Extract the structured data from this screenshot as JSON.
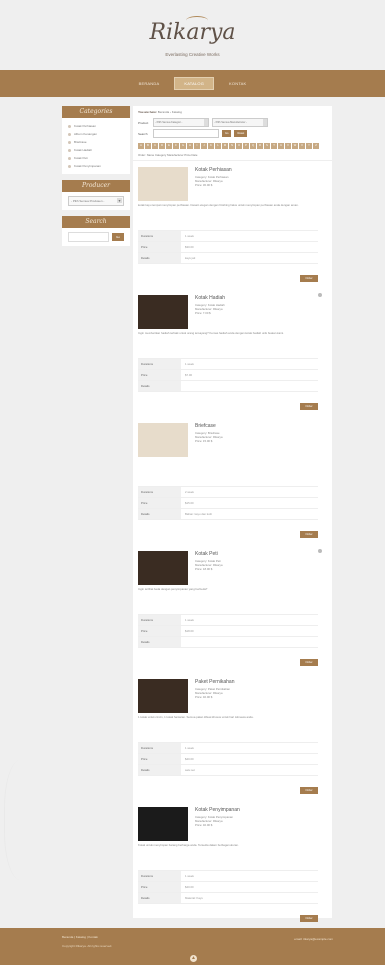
{
  "header": {
    "logo": "Rikarya",
    "tagline": "Everlasting Creative Works"
  },
  "nav": {
    "items": [
      "BERANDA",
      "KATALOG",
      "KONTAK"
    ],
    "active": "KATALOG"
  },
  "sidebar": {
    "categories_title": "Categories",
    "categories": [
      "Kotak Perhiasan",
      "Album Kenangan",
      "Briefcase",
      "Kotak Hadiah",
      "Kotak Peti",
      "Kotak Penyimpanan"
    ],
    "producer_title": "Producer",
    "producer_select": "- Pilih Semua Produsen -",
    "search_title": "Search",
    "search_button": "Go"
  },
  "main": {
    "breadcrumb_label": "You are here:",
    "breadcrumb_path": "Beranda › Katalog",
    "filter": {
      "product_label": "Product",
      "category_select": "- Pilih Semua Kategori -",
      "manufacturer_select": "- Pilih Semua Manufacturer -",
      "search_label": "Search",
      "go_button": "Go",
      "reset_button": "Reset"
    },
    "alphabet": [
      "A",
      "B",
      "C",
      "D",
      "E",
      "F",
      "G",
      "H",
      "I",
      "J",
      "K",
      "L",
      "M",
      "N",
      "O",
      "P",
      "Q",
      "R",
      "S",
      "T",
      "U",
      "V",
      "W",
      "X",
      "Y",
      "Z"
    ],
    "sort_label": "Order:",
    "sort_options": [
      "Name",
      "Category",
      "Manufacturer",
      "Price",
      "Date"
    ],
    "products": [
      {
        "title": "Kotak Perhiasan",
        "category": "Category: Kotak Perhiasan",
        "manufacturer": "Manufacturer: Rikarya",
        "price": "Price: 30.00 $",
        "desc": "kotak kayu tempat menyimpan perhiasan. Desain elegan dengan finishing halus untuk menyimpan perhiasan anda dengan aman.",
        "rows": [
          [
            "Durations",
            "1 week"
          ],
          [
            "Price",
            "$30.00"
          ],
          [
            "Details",
            "kayu jati"
          ]
        ],
        "order": "Order"
      },
      {
        "title": "Kotak Hadiah",
        "category": "Category: Kotak Hadiah",
        "manufacturer": "Manufacturer: Rikarya",
        "price": "Price: 7.00 $",
        "desc": "Ingin memberikan hadiah terbaik untuk orang tersayang? Kemas hadiah anda dengan kotak hadiah unik buatan kami.",
        "rows": [
          [
            "Durations",
            "1 week"
          ],
          [
            "Price",
            "$7.00"
          ],
          [
            "Details",
            ""
          ]
        ],
        "order": "Order"
      },
      {
        "title": "Briefcase",
        "category": "Category: Briefcase",
        "manufacturer": "Manufacturer: Rikarya",
        "price": "Price: 15.00 $",
        "desc": "",
        "rows": [
          [
            "Durations",
            "2 week"
          ],
          [
            "Price",
            "$15.00"
          ],
          [
            "Details",
            "Bahan: kayu dan kulit"
          ]
        ],
        "order": "Order"
      },
      {
        "title": "Kotak Peti",
        "category": "Category: Kotak Peti",
        "manufacturer": "Manufacturer: Rikarya",
        "price": "Price: 18.00 $",
        "desc": "Ingin terlihat beda dengan penyimpanan yang berbeda?",
        "rows": [
          [
            "Durations",
            "1 week"
          ],
          [
            "Price",
            "$18.00"
          ],
          [
            "Details",
            ""
          ]
        ],
        "order": "Order"
      },
      {
        "title": "Paket Pernikahan",
        "category": "Category: Paket Pernikahan",
        "manufacturer": "Manufacturer: Rikarya",
        "price": "Price: 40.00 $",
        "desc": "1 kotak untuk cincin, 1 kotak hantaran. Semua paket dibuat khusus untuk hari istimewa anda.",
        "rows": [
          [
            "Durations",
            "1 week"
          ],
          [
            "Price",
            "$40.00"
          ],
          [
            "Details",
            "satu set"
          ]
        ],
        "order": "Order"
      },
      {
        "title": "Kotak Penyimpanan",
        "category": "Category: Kotak Penyimpanan",
        "manufacturer": "Manufacturer: Rikarya",
        "price": "Price: 40.00 $",
        "desc": "Kotak untuk menyimpan barang berharga anda. Tersedia dalam berbagai ukuran.",
        "rows": [
          [
            "Durations",
            "1 week"
          ],
          [
            "Price",
            "$40.00"
          ],
          [
            "Details",
            "Material: Kayu"
          ]
        ],
        "order": "Order"
      }
    ]
  },
  "footer": {
    "links": "Beranda | Katalog | Kontak",
    "copyright": "Copyright Rikarya. All rights reserved.",
    "email": "email: rikarya@example.com",
    "top": "▲"
  }
}
